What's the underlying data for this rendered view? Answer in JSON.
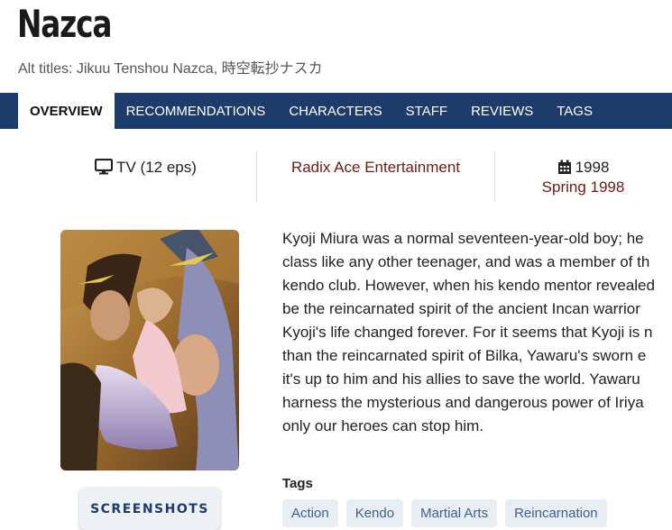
{
  "anime": {
    "title": "Nazca",
    "alt_titles": "Alt titles: Jikuu Tenshou Nazca, 時空転抄ナスカ"
  },
  "nav": {
    "tabs": [
      "OVERVIEW",
      "RECOMMENDATIONS",
      "CHARACTERS",
      "STAFF",
      "REVIEWS",
      "TAGS"
    ],
    "active": "OVERVIEW"
  },
  "info": {
    "format": "TV (12 eps)",
    "format_icon": "tv-icon",
    "studio": "Radix Ace Entertainment",
    "year": "1998",
    "year_icon": "calendar-icon",
    "season": "Spring 1998"
  },
  "synopsis": {
    "lines": [
      "Kyoji Miura was a normal seventeen-year-old boy; he",
      "class like any other teenager, and was a member of th",
      "kendo club. However, when his kendo mentor revealed",
      "be the reincarnated spirit of the ancient Incan warrior",
      "Kyoji's life changed forever. For it seems that Kyoji is n",
      "than the reincarnated spirit of Bilka, Yawaru's sworn e",
      "it's up to him and his allies to save the world. Yawaru",
      "harness the mysterious and dangerous power of Iriya",
      "only our heroes can stop him."
    ]
  },
  "buttons": {
    "screenshots": "SCREENSHOTS"
  },
  "tags": {
    "heading": "Tags",
    "items": [
      "Action",
      "Kendo",
      "Martial Arts",
      "Reincarnation"
    ]
  },
  "colors": {
    "navbar": "#1d3c6b",
    "accent_link": "#6e1a14",
    "chip_bg": "#e9edf4",
    "chip_text": "#3f5f8c"
  }
}
